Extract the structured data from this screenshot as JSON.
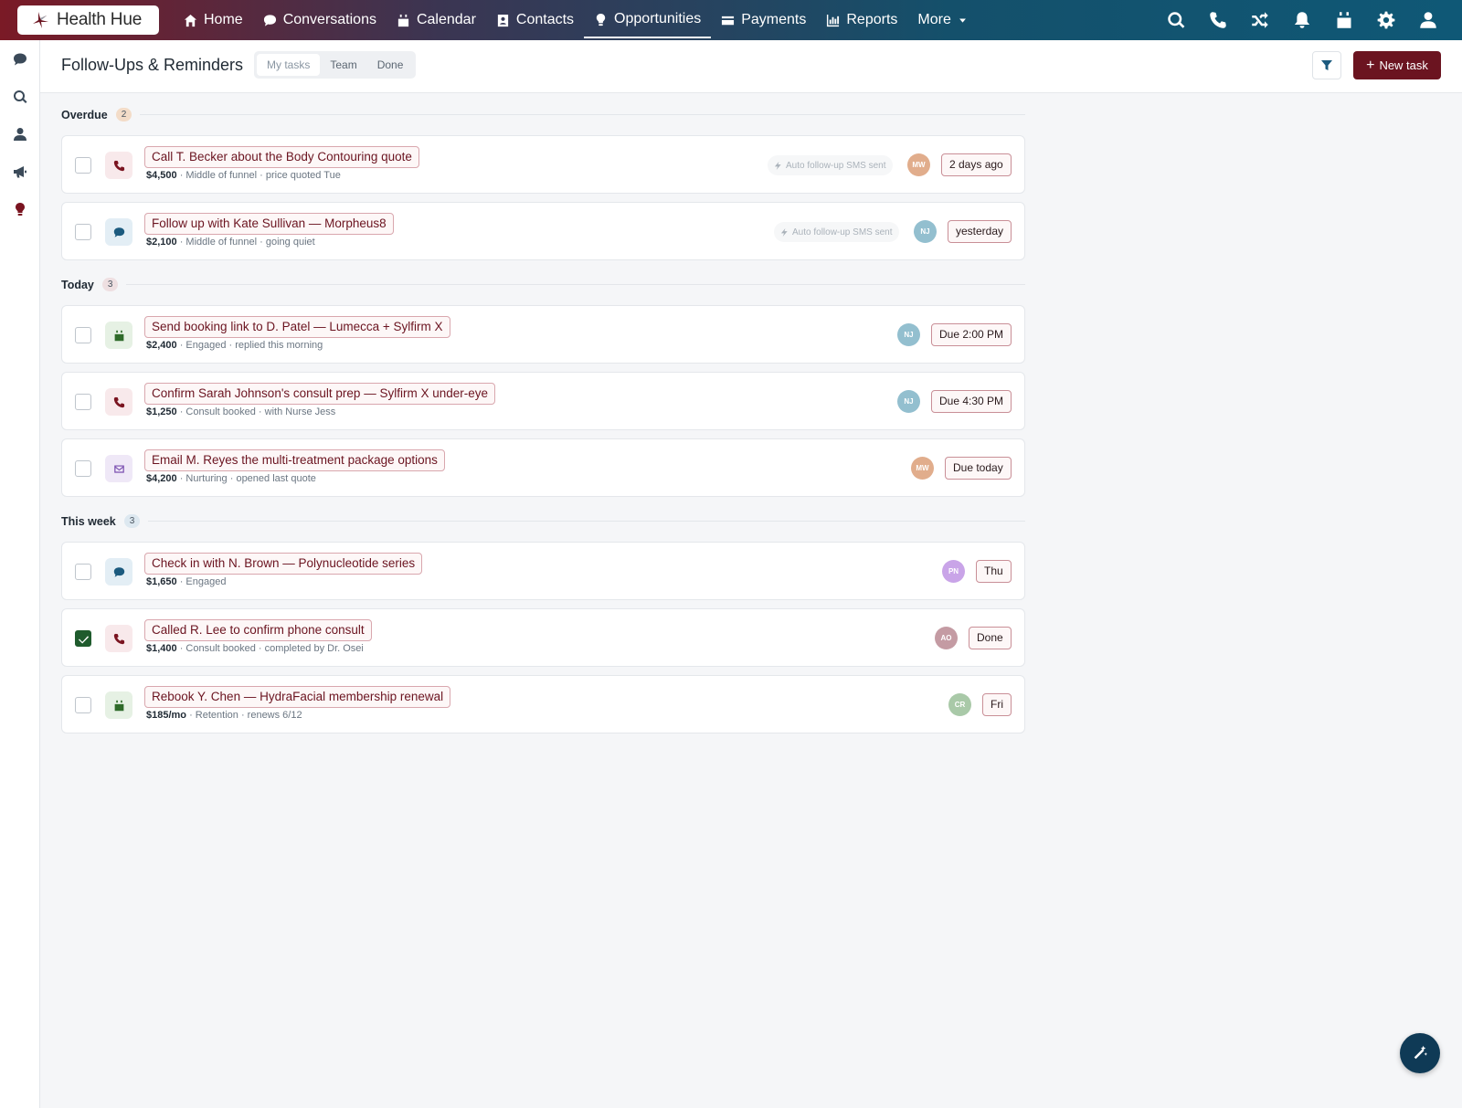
{
  "nav": {
    "logo": "Health Hue",
    "items": [
      {
        "label": "Home",
        "icon": "home-icon"
      },
      {
        "label": "Conversations",
        "icon": "chat-icon"
      },
      {
        "label": "Calendar",
        "icon": "calendar-icon"
      },
      {
        "label": "Contacts",
        "icon": "contact-card-icon"
      },
      {
        "label": "Opportunities",
        "icon": "lightbulb-icon"
      },
      {
        "label": "Payments",
        "icon": "credit-card-icon"
      },
      {
        "label": "Reports",
        "icon": "bar-chart-icon"
      },
      {
        "label": "More",
        "icon": "caret-down-icon"
      }
    ],
    "active": "Opportunities",
    "right_icons": [
      "search-icon",
      "phone-icon",
      "shuffle-icon",
      "bell-icon",
      "calendar-icon",
      "gear-icon",
      "user-icon"
    ]
  },
  "rail": {
    "icons": [
      "chat-icon",
      "search-icon",
      "user-icon",
      "megaphone-icon",
      "lightbulb-icon"
    ]
  },
  "header": {
    "title": "Follow-Ups & Reminders",
    "tabs": [
      "My tasks",
      "Team",
      "Done"
    ],
    "active_tab": "My tasks",
    "new_task_label": "New task"
  },
  "sections": [
    {
      "label": "Overdue",
      "count": "2",
      "color": "#f3dcc8",
      "tasks": [
        {
          "title": "Call T. Becker about the Body Contouring quote",
          "amount": "$4,500",
          "meta": " · Middle of funnel · price quoted Tue",
          "type": "phone",
          "auto": "Auto follow-up SMS sent",
          "avatar": "MW",
          "avatar_color": "#e1ad8c",
          "due": "2 days ago",
          "done": false
        },
        {
          "title": "Follow up with Kate Sullivan — Morpheus8",
          "amount": "$2,100",
          "meta": " · Middle of funnel · going quiet",
          "type": "chat",
          "auto": "Auto follow-up SMS sent",
          "avatar": "NJ",
          "avatar_color": "#93bfcf",
          "due": "yesterday",
          "done": false
        }
      ]
    },
    {
      "label": "Today",
      "count": "3",
      "color": "#eedfe1",
      "tasks": [
        {
          "title": "Send booking link to D. Patel — Lumecca + Sylfirm X",
          "amount": "$2,400",
          "meta": " · Engaged · replied this morning",
          "type": "calendar",
          "auto": "",
          "avatar": "NJ",
          "avatar_color": "#93bfcf",
          "due": "Due 2:00 PM",
          "done": false
        },
        {
          "title": "Confirm Sarah Johnson's consult prep — Sylfirm X under-eye",
          "amount": "$1,250",
          "meta": " · Consult booked · with Nurse Jess",
          "type": "phone",
          "auto": "",
          "avatar": "NJ",
          "avatar_color": "#93bfcf",
          "due": "Due 4:30 PM",
          "done": false
        },
        {
          "title": "Email M. Reyes the multi-treatment package options",
          "amount": "$4,200",
          "meta": " · Nurturing · opened last quote",
          "type": "email",
          "auto": "",
          "avatar": "MW",
          "avatar_color": "#e1ad8c",
          "due": "Due today",
          "done": false
        }
      ]
    },
    {
      "label": "This week",
      "count": "3",
      "color": "#dde8f0",
      "tasks": [
        {
          "title": "Check in with N. Brown — Polynucleotide series",
          "amount": "$1,650",
          "meta": " · Engaged",
          "type": "chat",
          "auto": "",
          "avatar": "PN",
          "avatar_color": "#c9a4e8",
          "due": "Thu",
          "done": false
        },
        {
          "title": "Called R. Lee to confirm phone consult",
          "amount": "$1,400",
          "meta": " · Consult booked · completed by Dr. Osei",
          "type": "phone",
          "auto": "",
          "avatar": "AO",
          "avatar_color": "#c49ba3",
          "due": "Done",
          "done": true
        },
        {
          "title": "Rebook Y. Chen — HydraFacial membership renewal",
          "amount": "$185/mo",
          "meta": " · Retention · renews 6/12",
          "type": "calendar",
          "auto": "",
          "avatar": "CR",
          "avatar_color": "#a9c9a8",
          "due": "Fri",
          "done": false
        }
      ]
    }
  ]
}
